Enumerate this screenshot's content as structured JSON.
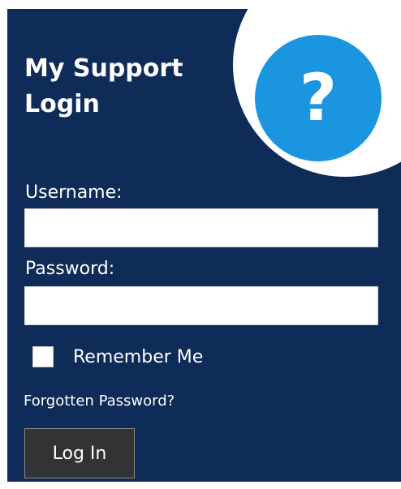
{
  "header": {
    "title_line1": "My Support",
    "title_line2": "Login",
    "help_icon_glyph": "?",
    "help_icon": "question-mark-icon"
  },
  "form": {
    "username_label": "Username:",
    "username_value": "",
    "password_label": "Password:",
    "password_value": "",
    "remember_label": "Remember Me",
    "remember_checked": false,
    "forgot_link": "Forgotten Password?",
    "login_button": "Log In"
  },
  "colors": {
    "panel_background": "#0f2b57",
    "help_badge": "#1b95e0",
    "button_background": "#333333",
    "text": "#ffffff"
  }
}
